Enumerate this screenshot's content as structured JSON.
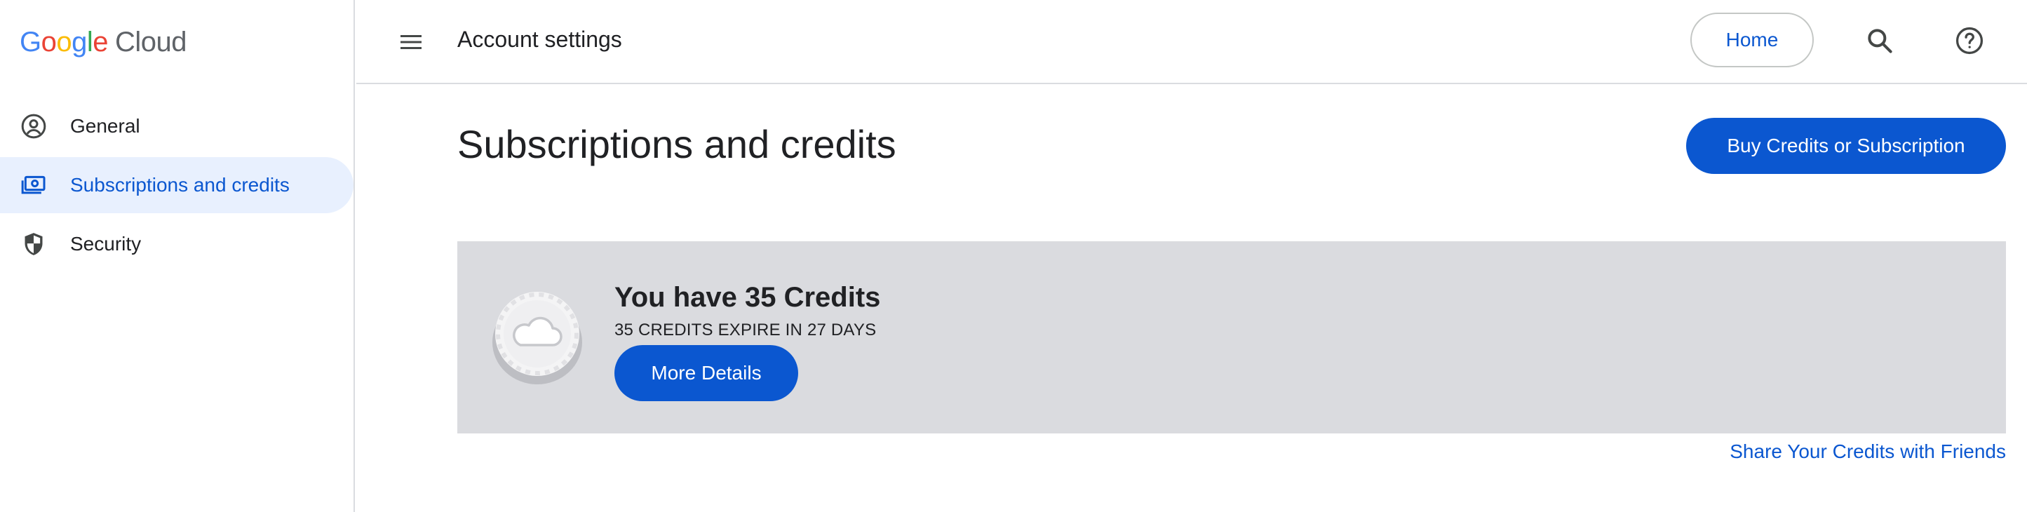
{
  "sidebar": {
    "logo": {
      "google": "Google",
      "product": "Cloud"
    },
    "items": [
      {
        "label": "General",
        "icon": "account-circle-icon",
        "active": false
      },
      {
        "label": "Subscriptions and credits",
        "icon": "payments-icon",
        "active": true
      },
      {
        "label": "Security",
        "icon": "shield-icon",
        "active": false
      }
    ]
  },
  "topbar": {
    "menu_icon": "menu-icon",
    "title": "Account settings",
    "home_label": "Home",
    "search_icon": "search-icon",
    "help_icon": "help-icon"
  },
  "main": {
    "page_title": "Subscriptions and credits",
    "buy_label": "Buy Credits or Subscription",
    "card": {
      "badge_icon": "cloud-badge-icon",
      "title": "You have 35 Credits",
      "subtitle": "35 CREDITS EXPIRE IN 27 DAYS",
      "details_label": "More Details"
    },
    "share_label": "Share Your Credits with Friends"
  },
  "colors": {
    "accent": "#0b57d0",
    "active_nav_bg": "#e8f0fe",
    "card_bg": "#dadbdf",
    "divider": "#dadce0"
  }
}
